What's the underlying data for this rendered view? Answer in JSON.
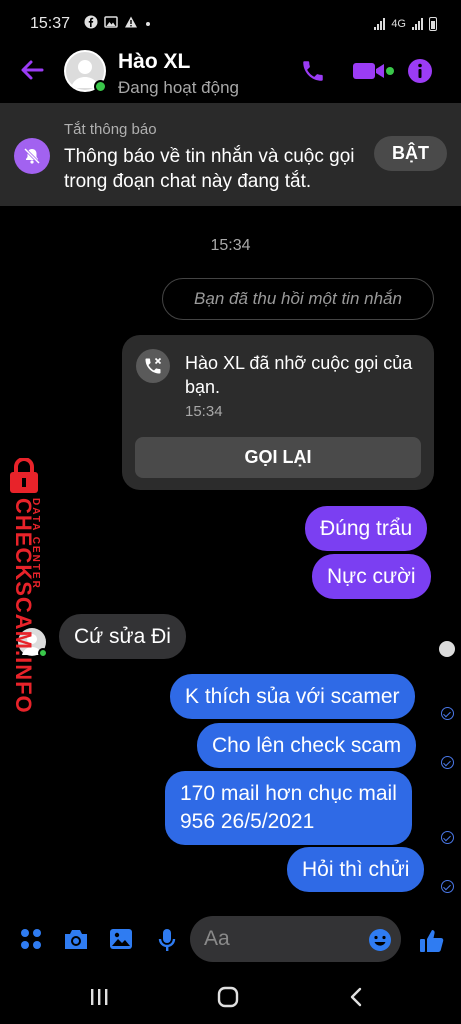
{
  "status_bar": {
    "time": "15:37",
    "network": "4G"
  },
  "header": {
    "name": "Hào XL",
    "status": "Đang hoạt động"
  },
  "mute_banner": {
    "title": "Tắt thông báo",
    "text": "Thông báo về tin nhắn và cuộc gọi trong đoạn chat này đang tắt.",
    "button": "BẬT"
  },
  "conversation": {
    "timestamp": "15:34",
    "recalled_message": "Bạn đã thu hồi một tin nhắn",
    "missed_call": {
      "text": "Hào XL đã nhỡ cuộc gọi của bạn.",
      "time": "15:34",
      "button": "GỌI LẠI"
    },
    "messages": [
      {
        "text": "Đúng trẩu",
        "sender": "me"
      },
      {
        "text": "Nực cười",
        "sender": "me"
      },
      {
        "text": "Cứ sửa Đi",
        "sender": "them"
      },
      {
        "text": "K thích sủa với scamer",
        "sender": "me"
      },
      {
        "text": "Cho lên check scam",
        "sender": "me"
      },
      {
        "text": "170 mail hơn chục mail\n956 26/5/2021",
        "sender": "me"
      },
      {
        "text": "Hỏi thì chửi",
        "sender": "me"
      }
    ]
  },
  "watermark": {
    "main": "CHECKSCAM.INFO",
    "sub": "DATA CENTER"
  },
  "composer": {
    "placeholder": "Aa"
  },
  "colors": {
    "accent_purple": "#9b3cf5",
    "bubble_purple": "#7b3ff2",
    "bubble_blue": "#2f6ae6",
    "composer_blue": "#2f7cf2",
    "watermark_red": "#e8232a"
  }
}
